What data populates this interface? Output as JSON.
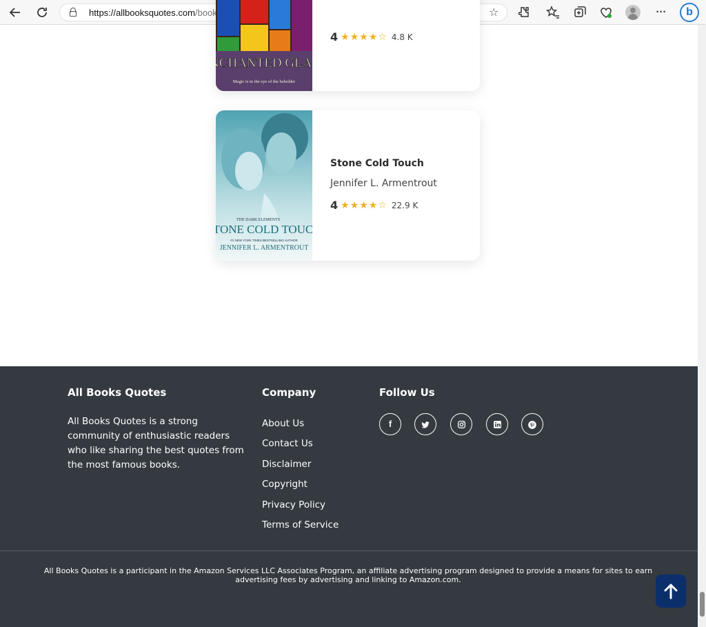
{
  "browser": {
    "url_host": "https://allbooksquotes.com",
    "url_path": "/books/empire-of-storms-quotes/",
    "icons": [
      "back-arrow-icon",
      "refresh-icon",
      "lock-icon",
      "read-aloud-icon",
      "favorite-star-icon",
      "extensions-icon",
      "favorites-icon",
      "collections-icon",
      "browser-essentials-icon",
      "profile-avatar-icon",
      "more-menu-icon",
      "bing-icon"
    ]
  },
  "books": [
    {
      "cover_title": "ENCHANTED GLASS",
      "cover_tagline": "Magic is in the eye of the beholder",
      "rating": "4",
      "stars": "★★★★☆",
      "rating_value": 4,
      "count": "4.8 K"
    },
    {
      "title": "Stone Cold Touch",
      "author": "Jennifer L. Armentrout",
      "cover_series": "THE DARK ELEMENTS",
      "cover_title": "STONE COLD TOUCH",
      "cover_bestseller": "#1 NEW YORK TIMES BESTSELLING AUTHOR",
      "cover_author": "JENNIFER L. ARMENTROUT",
      "rating": "4",
      "stars": "★★★★☆",
      "rating_value": 4,
      "count": "22.9 K"
    }
  ],
  "footer": {
    "brand_heading": "All Books Quotes",
    "about": "All Books Quotes is a strong community of enthusiastic readers who like sharing the best quotes from the most famous books.",
    "company_heading": "Company",
    "links": [
      "About Us",
      "Contact Us",
      "Disclaimer",
      "Copyright",
      "Privacy Policy",
      "Terms of Service"
    ],
    "follow_heading": "Follow Us",
    "socials": [
      "facebook-icon",
      "twitter-icon",
      "instagram-icon",
      "linkedin-icon",
      "pinterest-icon"
    ],
    "disclaimer": "All Books Quotes is a participant in the Amazon Services LLC Associates Program, an affiliate advertising program designed to provide a means for sites to earn advertising fees by advertising and linking to Amazon.com."
  },
  "colors": {
    "footer_bg": "#343a40",
    "star": "#f2b01e",
    "back_to_top": "#0b2f6b"
  }
}
